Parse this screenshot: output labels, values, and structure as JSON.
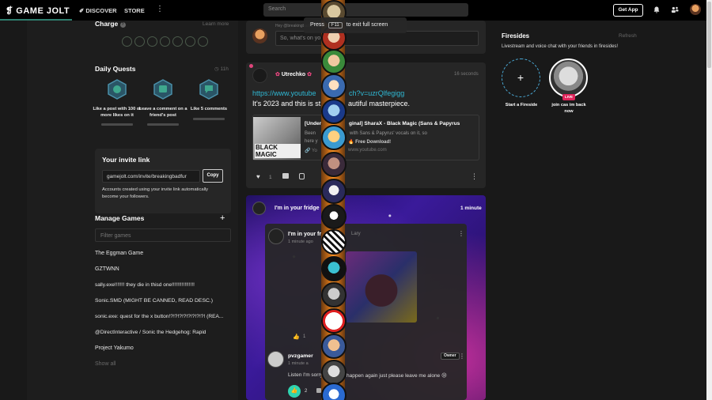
{
  "nav": {
    "logo": "GAME JOLT",
    "discover": "DISCOVER",
    "store": "STORE",
    "search_placeholder": "Search",
    "get_app": "Get App"
  },
  "toast": {
    "press": "Press",
    "key": "F11",
    "suffix": "to exit full screen"
  },
  "charge": {
    "title": "Charge",
    "learn_more": "Learn more",
    "slots": 7
  },
  "quests": {
    "title": "Daily Quests",
    "timer": "11h",
    "items": [
      {
        "label": "Like a post with 100 or more likes on it",
        "color": "#3fa88e"
      },
      {
        "label": "Leave a comment on a friend's post",
        "color": "#3fa88e"
      },
      {
        "label": "Like 5 comments",
        "color": "#3fa88e"
      }
    ]
  },
  "invite": {
    "title": "Your invite link",
    "link": "gamejolt.com/invite/breakingbadfur",
    "copy": "Copy",
    "note": "Accounts created using your invite link automatically become your followers."
  },
  "manage": {
    "title": "Manage Games",
    "filter_placeholder": "Filter games",
    "games": [
      "The Eggman Game",
      "GZTWNN",
      "sally.exe!!!!!!! they die in thisd one!!!!!!!!!!!!!!!!",
      "Sonic.SMD (MIGHT BE CANNED, READ DESC.)",
      "sonic.exe: quest for the x button!?!?!?!?!?!?!?!?! (REA...",
      "@DirectInteractive / Sonic the Hedgehog: Rapid",
      "Project Yakumo"
    ],
    "show_all": "Show all"
  },
  "composer": {
    "hint": "Hey @breakingbadfur",
    "placeholder": "So, what's on yo"
  },
  "post1": {
    "author": "Utrechko",
    "time": "16 seconds",
    "link": "https://www.youtube.com/watch?v=uzrQlfegigg",
    "link_visible": "https://www.youtube",
    "link_visible_end": "ch?v=uzrQlfegigg",
    "text_start": "It's 2023 and this is st",
    "text_end": "autiful masterpiece.",
    "embed_title_start": "[Under",
    "embed_title_end": "ginal] SharaX - Black Magic (Sans & Papyrus",
    "embed_desc_start": "Been",
    "embed_desc_end": "with Sans & Papyrus' vocals on it, so",
    "embed_desc2_start": "here y",
    "embed_desc2_end": "Free Download!",
    "embed_domain": "www.youtube.com",
    "thumb_text": "BLACK MAGIC",
    "likes": "1"
  },
  "post2": {
    "author": "I'm in your fridge",
    "time": "1 minute",
    "inner_author": "I'm in your frid",
    "inner_author_end": "Lary",
    "inner_time": "1 minute ago",
    "inner_likes": "1",
    "commenter": "pvzgamer",
    "commenter_time": "1 minute a",
    "owner": "Owner",
    "comment_start": "Listen I'm sorry",
    "comment_end": "happen again just please leave me alone",
    "comment_likes": "2"
  },
  "firesides": {
    "title": "Firesides",
    "refresh": "Refresh",
    "subtitle": "Livestream and voice chat with your friends in firesides!",
    "start_label": "Start a Fireside",
    "live_badge": "LIVE",
    "live_label": "join cas im back now"
  },
  "colors": {
    "teal": "#2f7f6f",
    "link": "#2fb8d4",
    "orange": "#f39225"
  }
}
